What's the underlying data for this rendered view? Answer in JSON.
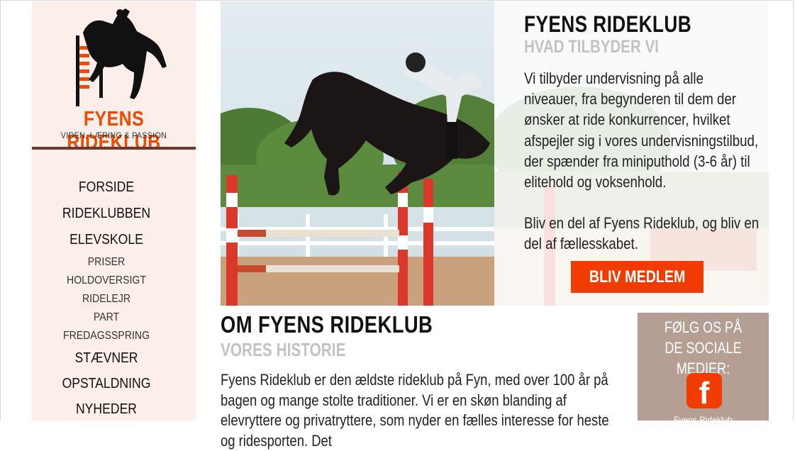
{
  "logo": {
    "brand": "FYENS RIDEKLUB",
    "tagline": "VIDEN, LÆRING & PASSION"
  },
  "nav": {
    "forside": "FORSIDE",
    "rideklubben": "RIDEKLUBBEN",
    "elevskole": "ELEVSKOLE",
    "priser": "PRISER",
    "holdoversigt": "HOLDOVERSIGT",
    "ridelejr": "RIDELEJR",
    "part": "PART",
    "fredagsspring": "FREDAGSSPRING",
    "staevner": "STÆVNER",
    "opstaldning": "OPSTALDNING",
    "nyheder": "NYHEDER"
  },
  "hero": {
    "title": "FYENS RIDEKLUB",
    "subtitle": "HVAD TILBYDER VI",
    "paragraph1": "Vi tilbyder undervisning på alle niveauer, fra begynderen til dem der ønsker at ride konkurrencer, hvilket afspejler sig i vores undervisningstilbud, der spænder fra miniputhold (3-6 år) til elitehold og voksenhold.",
    "paragraph2": "Bliv en del af Fyens Rideklub, og bliv en del af fællesskabet.",
    "cta": "BLIV MEDLEM"
  },
  "about": {
    "title": "OM FYENS RIDEKLUB",
    "subtitle": "VORES HISTORIE",
    "text": "Fyens Rideklub er den ældste rideklub på Fyn, med over 100 år på bagen og mange stolte traditioner. Vi er en skøn blanding af elevryttere og privatryttere, som nyder en fælles interesse for heste og ridesporten. Det"
  },
  "social": {
    "line1": "FØLG OS PÅ",
    "line2": "DE SOCIALE MEDIER:",
    "icon": "facebook-icon",
    "caption": "Fyens Rideklub"
  },
  "colors": {
    "accent": "#f03c00",
    "sidebar_bg": "#fcefe9",
    "social_bg": "#b59f94",
    "logo_line": "#6b3a2f"
  }
}
